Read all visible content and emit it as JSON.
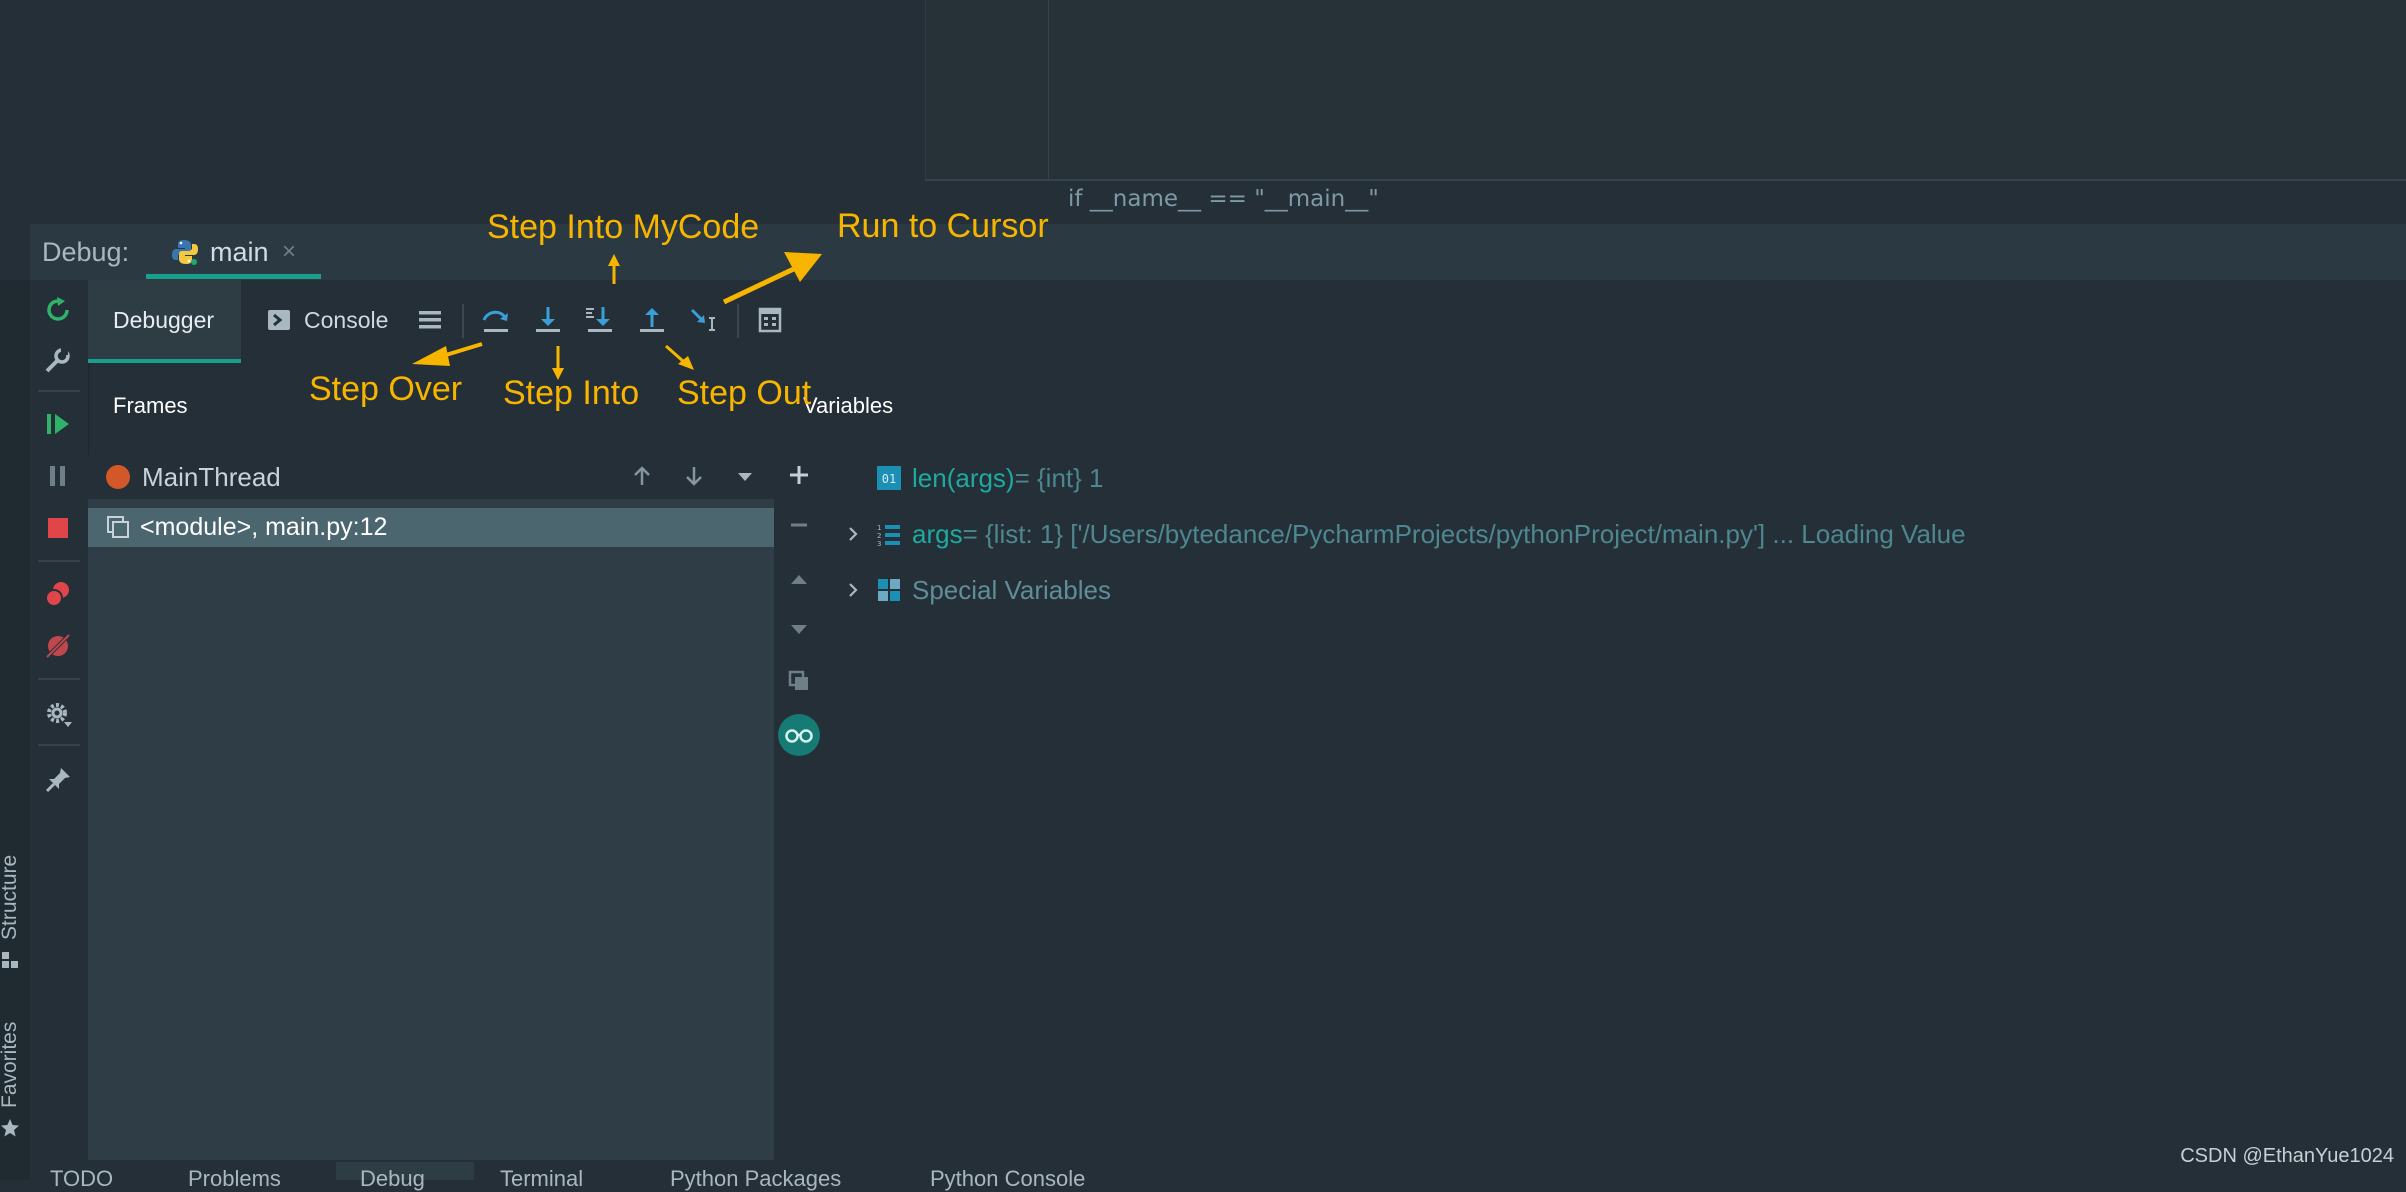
{
  "editor": {
    "code_line": "if __name__ == \"__main__\""
  },
  "debug_bar": {
    "label": "Debug:",
    "tab_label": "main",
    "close_glyph": "×"
  },
  "tabs": {
    "debugger": "Debugger",
    "console": "Console"
  },
  "panels": {
    "frames": "Frames",
    "variables": "Variables"
  },
  "thread": {
    "name": "MainThread"
  },
  "frame": {
    "label": "<module>, main.py:12"
  },
  "variables": [
    {
      "name": "len(args)",
      "value": " = {int} 1",
      "expandable": false
    },
    {
      "name": "args",
      "value": " = {list: 1} ['/Users/bytedance/PycharmProjects/pythonProject/main.py'] ... Loading Value",
      "expandable": true
    },
    {
      "name": "Special Variables",
      "value": "",
      "expandable": true
    }
  ],
  "annotations": {
    "step_into_mycode": "Step Into MyCode",
    "run_to_cursor": "Run to Cursor",
    "step_over": "Step Over",
    "step_into": "Step Into",
    "step_out": "Step Out"
  },
  "side_labels": {
    "structure": "Structure",
    "favorites": "Favorites"
  },
  "bottom_tabs": [
    "TODO",
    "Problems",
    "Debug",
    "Terminal",
    "Python Packages",
    "Python Console"
  ],
  "watermark": "CSDN @EthanYue1024",
  "colors": {
    "accent": "#18a08c",
    "annotation": "#f7b500",
    "background": "#242f37",
    "selected_frame": "#4c6670"
  }
}
